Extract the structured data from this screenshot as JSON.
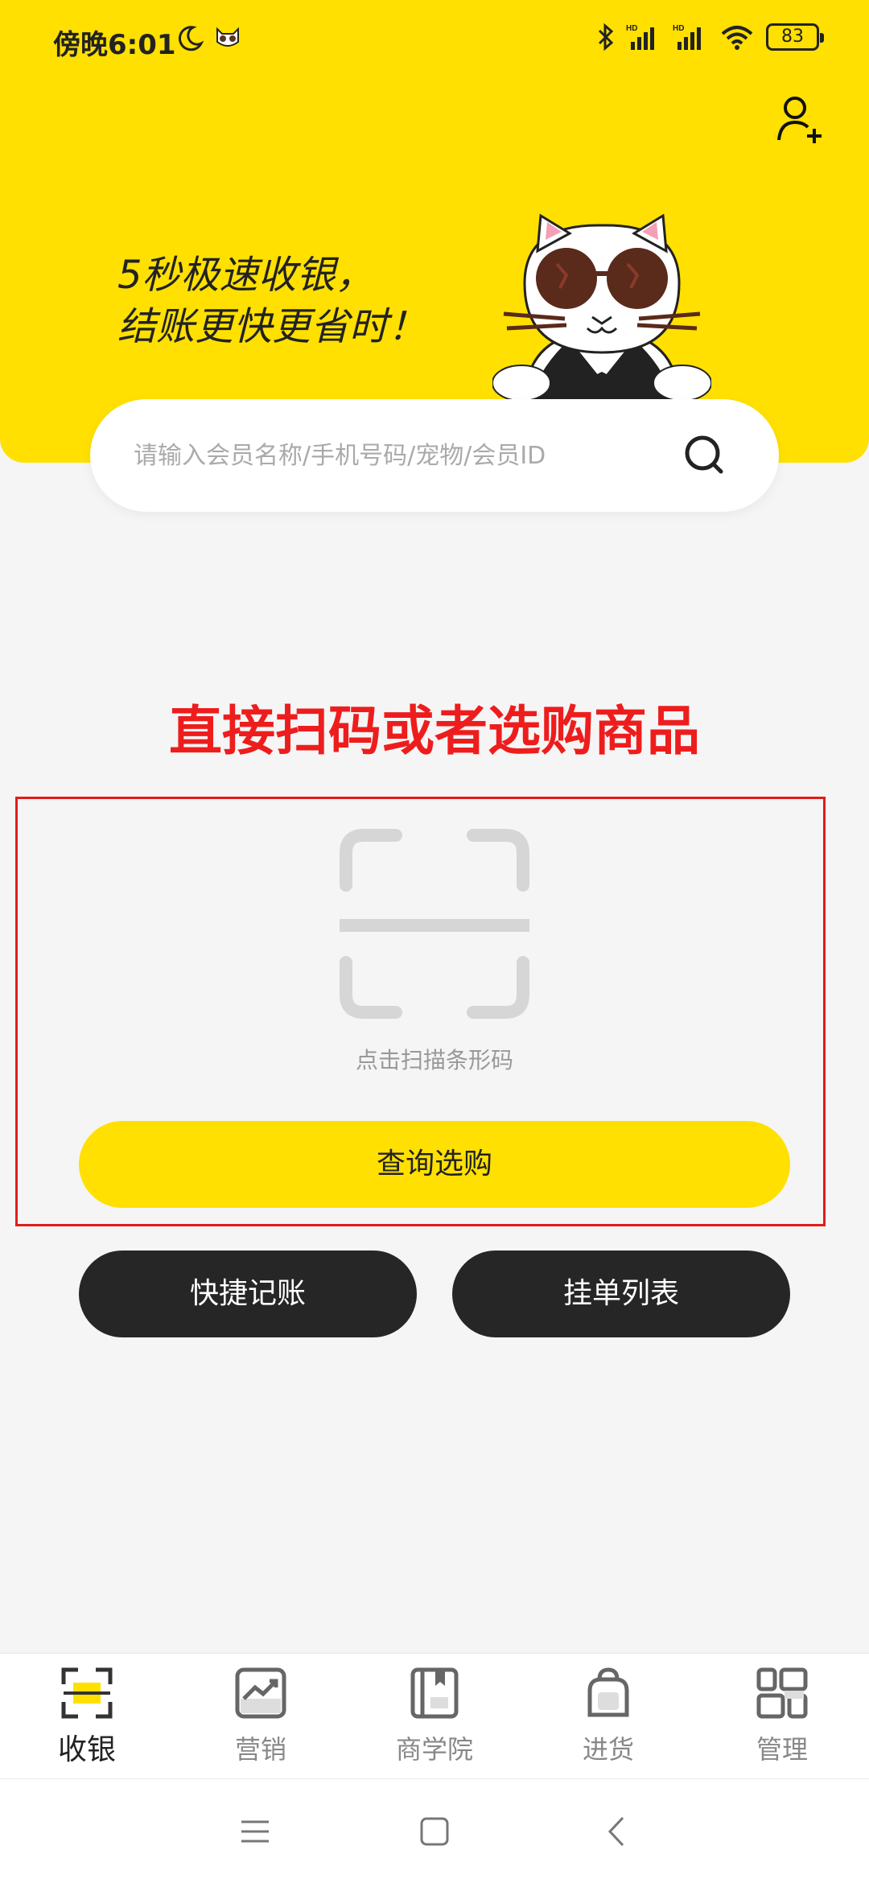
{
  "status_bar": {
    "time": "傍晚6:01",
    "battery": "83",
    "icons": [
      "moon-icon",
      "cat-mini-icon",
      "bluetooth-icon",
      "signal-hd-icon",
      "signal-hd-icon",
      "wifi-icon",
      "battery-icon"
    ]
  },
  "header": {
    "slogan_line1": "5秒极速收银，",
    "slogan_line2": "结账更快更省时！",
    "accent_color": "#ffe000",
    "add_user_icon": "add-user-icon",
    "mascot_icon": "sunglasses-cat-mascot"
  },
  "search": {
    "placeholder": "请输入会员名称/手机号码/宠物/会员ID",
    "value": ""
  },
  "annotation": {
    "text": "直接扫码或者选购商品",
    "color": "#ee1d1d"
  },
  "scan": {
    "label": "点击扫描条形码"
  },
  "buttons": {
    "query": "查询选购",
    "quick_bookkeeping": "快捷记账",
    "pending_list": "挂单列表"
  },
  "nav": {
    "items": [
      {
        "label": "收银",
        "icon": "scan-cashier-icon",
        "active": true
      },
      {
        "label": "营销",
        "icon": "trend-chart-icon",
        "active": false
      },
      {
        "label": "商学院",
        "icon": "book-icon",
        "active": false
      },
      {
        "label": "进货",
        "icon": "bag-icon",
        "active": false
      },
      {
        "label": "管理",
        "icon": "grid-icon",
        "active": false
      }
    ]
  },
  "system_nav": {
    "icons": [
      "menu-icon",
      "home-icon",
      "back-icon"
    ]
  }
}
